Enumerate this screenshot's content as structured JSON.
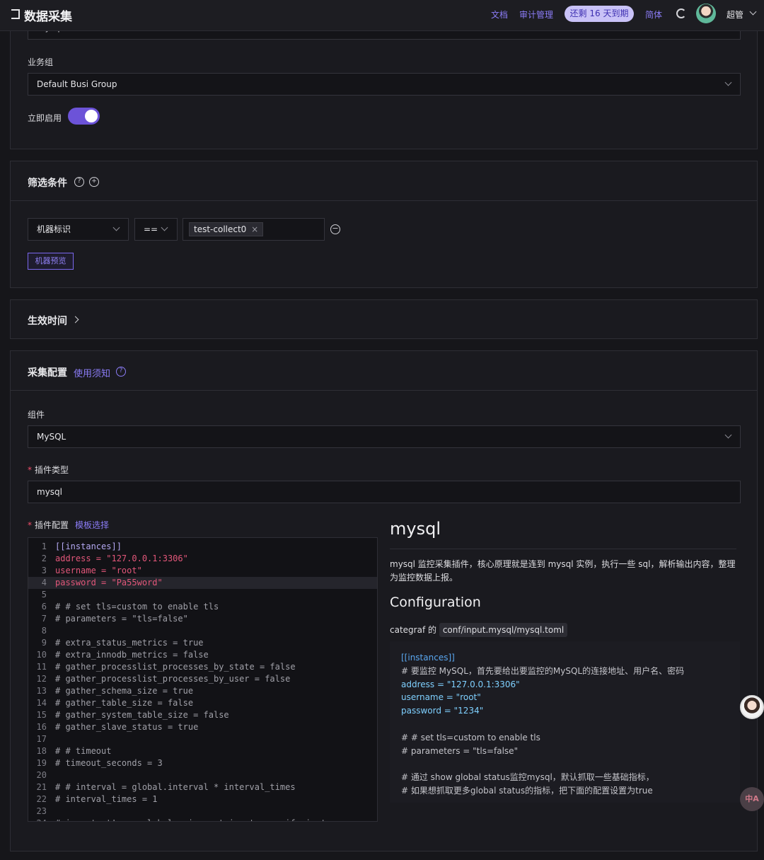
{
  "header": {
    "title": "数据采集",
    "links": [
      "文档",
      "审计管理"
    ],
    "expiry_badge": "还剩 16 天到期",
    "language": "简体",
    "user": "超管"
  },
  "basic": {
    "top_value": "mysql",
    "busi_group_label": "业务组",
    "busi_group_value": "Default Busi Group",
    "enable_label": "立即启用",
    "enabled": true
  },
  "filter": {
    "title": "筛选条件",
    "key_select": "机器标识",
    "operator": "==",
    "tag_value": "test-collect0",
    "preview_button": "机器预览"
  },
  "effective_time": {
    "title": "生效时间"
  },
  "collect": {
    "title": "采集配置",
    "usage_link": "使用须知",
    "component_label": "组件",
    "component_value": "MySQL",
    "plugin_type_label": "插件类型",
    "plugin_type_value": "mysql",
    "plugin_config_label": "插件配置",
    "template_link": "模板选择",
    "code_lines": [
      "[[instances]]",
      "address = \"127.0.0.1:3306\"",
      "username = \"root\"",
      "password = \"Pa55word\"",
      "",
      "# # set tls=custom to enable tls",
      "# parameters = \"tls=false\"",
      "",
      "# extra_status_metrics = true",
      "# extra_innodb_metrics = false",
      "# gather_processlist_processes_by_state = false",
      "# gather_processlist_processes_by_user = false",
      "# gather_schema_size = true",
      "# gather_table_size = false",
      "# gather_system_table_size = false",
      "# gather_slave_status = true",
      "",
      "# # timeout",
      "# timeout_seconds = 3",
      "",
      "# # interval = global.interval * interval_times",
      "# interval_times = 1",
      "",
      "# important! use global unique string to specify instance"
    ]
  },
  "doc": {
    "title": "mysql",
    "intro_line1": "mysql 监控采集插件，核心原理就是连到 mysql 实例，执行一些 sql，解析输出内容，整理",
    "intro_line2": "为监控数据上报。",
    "config_heading": "Configuration",
    "config_path_prefix": "categraf 的",
    "config_path": "conf/input.mysql/mysql.toml",
    "sample_lines": [
      "[[instances]]",
      "# 要监控 MySQL，首先要给出要监控的MySQL的连接地址、用户名、密码",
      "address = \"127.0.0.1:3306\"",
      "username = \"root\"",
      "password = \"1234\"",
      "",
      "# # set tls=custom to enable tls",
      "# parameters = \"tls=false\"",
      "",
      "# 通过 show global status监控mysql，默认抓取一些基础指标，",
      "# 如果想抓取更多global status的指标，把下面的配置设置为true"
    ]
  },
  "float": {
    "translate_label": "中A"
  }
}
